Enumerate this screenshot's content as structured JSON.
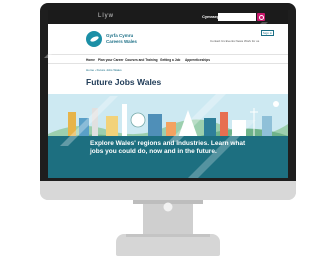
{
  "topbar": {
    "gov_logo": "Llyw",
    "language_link": "Cymraeg",
    "search_placeholder": "",
    "colors": {
      "bar": "#1b1b1b",
      "search_button": "#c9176b"
    }
  },
  "header": {
    "brand_line1": "Gyrfa Cymru",
    "brand_line2": "Careers Wales",
    "signin_label": "Sign in",
    "util_links": "Contact Us  Events  News  Work for us"
  },
  "nav": {
    "items": [
      {
        "label": "Home"
      },
      {
        "label": "Plan your Career"
      },
      {
        "label": "Courses and Training"
      },
      {
        "label": "Getting a Job"
      },
      {
        "label": "Apprenticeships"
      }
    ]
  },
  "breadcrumb": "Home › Future Jobs Wales",
  "page": {
    "title": "Future Jobs Wales"
  },
  "hero": {
    "text": "Explore Wales' regions and industries. Learn what jobs you could do, now and in the future.",
    "band_color": "#1d6f80"
  },
  "icons": [
    "search-icon",
    "brand-logo-icon",
    "power-button-icon"
  ]
}
